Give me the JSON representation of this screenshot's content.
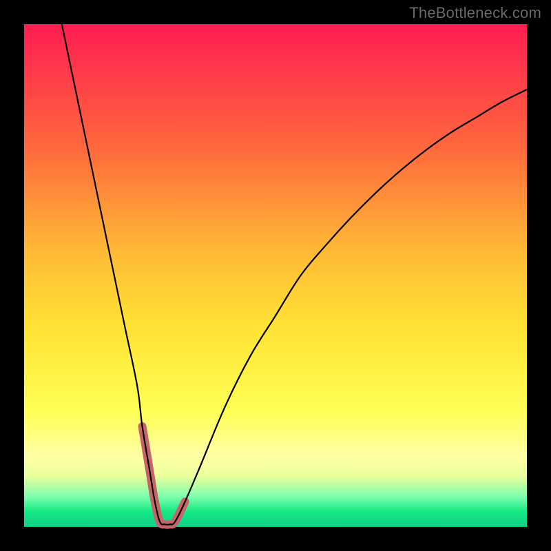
{
  "watermark": "TheBottleneck.com",
  "chart_data": {
    "type": "line",
    "title": "",
    "xlabel": "",
    "ylabel": "",
    "xlim": [
      0,
      100
    ],
    "ylim": [
      0,
      100
    ],
    "series": [
      {
        "name": "bottleneck-curve",
        "x": [
          7.5,
          10,
          12.5,
          15,
          17.5,
          20,
          22.5,
          23.5,
          25,
          26,
          27,
          28,
          29,
          30,
          32,
          35,
          40,
          45,
          50,
          55,
          60,
          65,
          70,
          75,
          80,
          85,
          90,
          95,
          100
        ],
        "values": [
          100,
          88,
          76,
          64,
          52,
          40,
          28,
          20,
          11,
          5,
          1,
          0.5,
          0.5,
          1,
          5,
          12,
          24,
          34,
          42,
          50,
          56,
          61.5,
          66.5,
          71,
          75,
          78.5,
          81.5,
          84.5,
          87
        ]
      },
      {
        "name": "highlight-segment",
        "x": [
          23.5,
          25,
          26,
          27,
          28,
          29,
          30,
          32
        ],
        "values": [
          20,
          11,
          5,
          1,
          0.5,
          0.5,
          1,
          5
        ]
      }
    ],
    "colors": {
      "curve": "#000000",
      "highlight": "#c9636a"
    },
    "curve_stroke_width": 2.2,
    "highlight_stroke_width": 12
  }
}
